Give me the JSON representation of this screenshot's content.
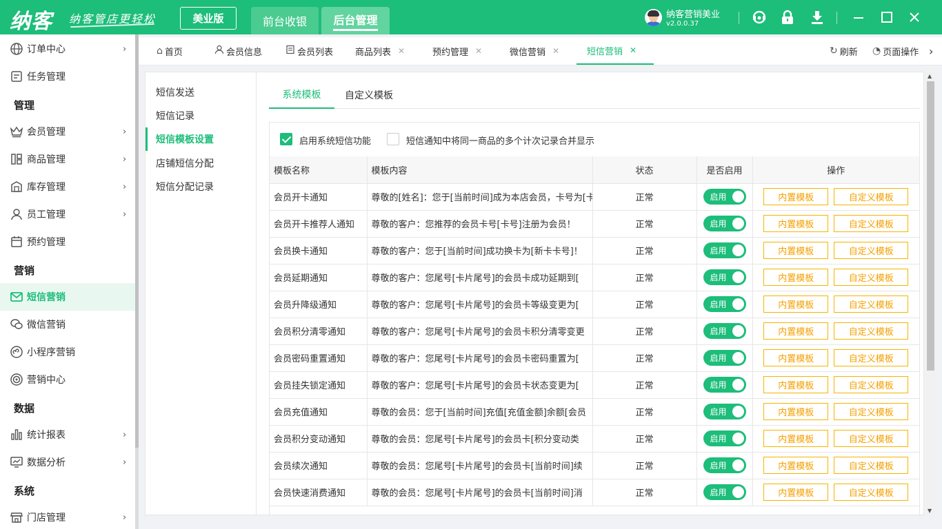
{
  "app": {
    "logo": "纳客",
    "slogan": "纳客管店更轻松",
    "edition": "美业版",
    "top_tabs": [
      "前台收银",
      "后台管理"
    ],
    "user_name": "纳客营销美业",
    "version": "v2.0.0.37"
  },
  "sidebar": {
    "items": [
      {
        "label": "订单中心",
        "icon": "globe-icon",
        "chevron": "›"
      },
      {
        "label": "任务管理",
        "icon": "task-icon",
        "chevron": ""
      },
      {
        "section": "管理"
      },
      {
        "label": "会员管理",
        "icon": "crown-icon",
        "chevron": "›"
      },
      {
        "label": "商品管理",
        "icon": "goods-icon",
        "chevron": "›"
      },
      {
        "label": "库存管理",
        "icon": "warehouse-icon",
        "chevron": "›"
      },
      {
        "label": "员工管理",
        "icon": "user-icon",
        "chevron": "›"
      },
      {
        "label": "预约管理",
        "icon": "calendar-icon",
        "chevron": ""
      },
      {
        "section": "营销"
      },
      {
        "label": "短信营销",
        "icon": "mail-icon",
        "chevron": "",
        "active": true
      },
      {
        "label": "微信营销",
        "icon": "wechat-icon",
        "chevron": ""
      },
      {
        "label": "小程序营销",
        "icon": "miniprogram-icon",
        "chevron": ""
      },
      {
        "label": "营销中心",
        "icon": "target-icon",
        "chevron": ""
      },
      {
        "section": "数据"
      },
      {
        "label": "统计报表",
        "icon": "bar-chart-icon",
        "chevron": "›"
      },
      {
        "label": "数据分析",
        "icon": "analysis-icon",
        "chevron": "›"
      },
      {
        "section": "系统"
      },
      {
        "label": "门店管理",
        "icon": "store-icon",
        "chevron": "›"
      }
    ]
  },
  "page_tabs": [
    {
      "label": "首页",
      "icon": "home-icon",
      "closable": false
    },
    {
      "label": "会员信息",
      "icon": "member-icon",
      "closable": false
    },
    {
      "label": "会员列表",
      "icon": "list-icon",
      "closable": false
    },
    {
      "label": "商品列表",
      "closable": true
    },
    {
      "label": "预约管理",
      "closable": true
    },
    {
      "label": "微信营销",
      "closable": true
    },
    {
      "label": "短信营销",
      "closable": true,
      "active": true
    }
  ],
  "tab_actions": {
    "refresh": "刷新",
    "page_ops": "页面操作",
    "more": "›"
  },
  "subnav": [
    "短信发送",
    "短信记录",
    "短信模板设置",
    "店铺短信分配",
    "短信分配记录"
  ],
  "inner_tabs": [
    "系统模板",
    "自定义模板"
  ],
  "options": {
    "enable_sms": {
      "label": "启用系统短信功能",
      "checked": true
    },
    "merge_records": {
      "label": "短信通知中将同一商品的多个计次记录合并显示",
      "checked": false
    }
  },
  "table": {
    "headers": [
      "模板名称",
      "模板内容",
      "状态",
      "是否启用",
      "操作"
    ],
    "toggle_label": "启用",
    "btn_builtin": "内置模板",
    "btn_custom": "自定义模板",
    "rows": [
      {
        "name": "会员开卡通知",
        "content": "尊敬的[姓名]：您于[当前时间]成为本店会员，卡号为[卡号]",
        "status": "正常"
      },
      {
        "name": "会员开卡推荐人通知",
        "content": "尊敬的客户：您推荐的会员卡号[卡号]注册为会员！",
        "status": "正常"
      },
      {
        "name": "会员换卡通知",
        "content": "尊敬的客户：您于[当前时间]成功换卡为[新卡卡号]！",
        "status": "正常"
      },
      {
        "name": "会员延期通知",
        "content": "尊敬的客户：您尾号[卡片尾号]的会员卡成功延期到[",
        "status": "正常"
      },
      {
        "name": "会员升降级通知",
        "content": "尊敬的客户：您尾号[卡片尾号]的会员卡等级变更为[",
        "status": "正常"
      },
      {
        "name": "会员积分清零通知",
        "content": "尊敬的客户：您尾号[卡片尾号]的会员卡积分清零变更",
        "status": "正常"
      },
      {
        "name": "会员密码重置通知",
        "content": "尊敬的客户：您尾号[卡片尾号]的会员卡密码重置为[",
        "status": "正常"
      },
      {
        "name": "会员挂失锁定通知",
        "content": "尊敬的客户：您尾号[卡片尾号]的会员卡状态变更为[",
        "status": "正常"
      },
      {
        "name": "会员充值通知",
        "content": "尊敬的会员：您于[当前时间]充值[充值金额]余额[会员",
        "status": "正常"
      },
      {
        "name": "会员积分变动通知",
        "content": "尊敬的会员：您尾号[卡片尾号]的会员卡[积分变动类",
        "status": "正常"
      },
      {
        "name": "会员续次通知",
        "content": "尊敬的会员：您尾号[卡片尾号]的会员卡[当前时间]续",
        "status": "正常"
      },
      {
        "name": "会员快速消费通知",
        "content": "尊敬的会员：您尾号[卡片尾号]的会员卡[当前时间]消",
        "status": "正常"
      }
    ]
  }
}
